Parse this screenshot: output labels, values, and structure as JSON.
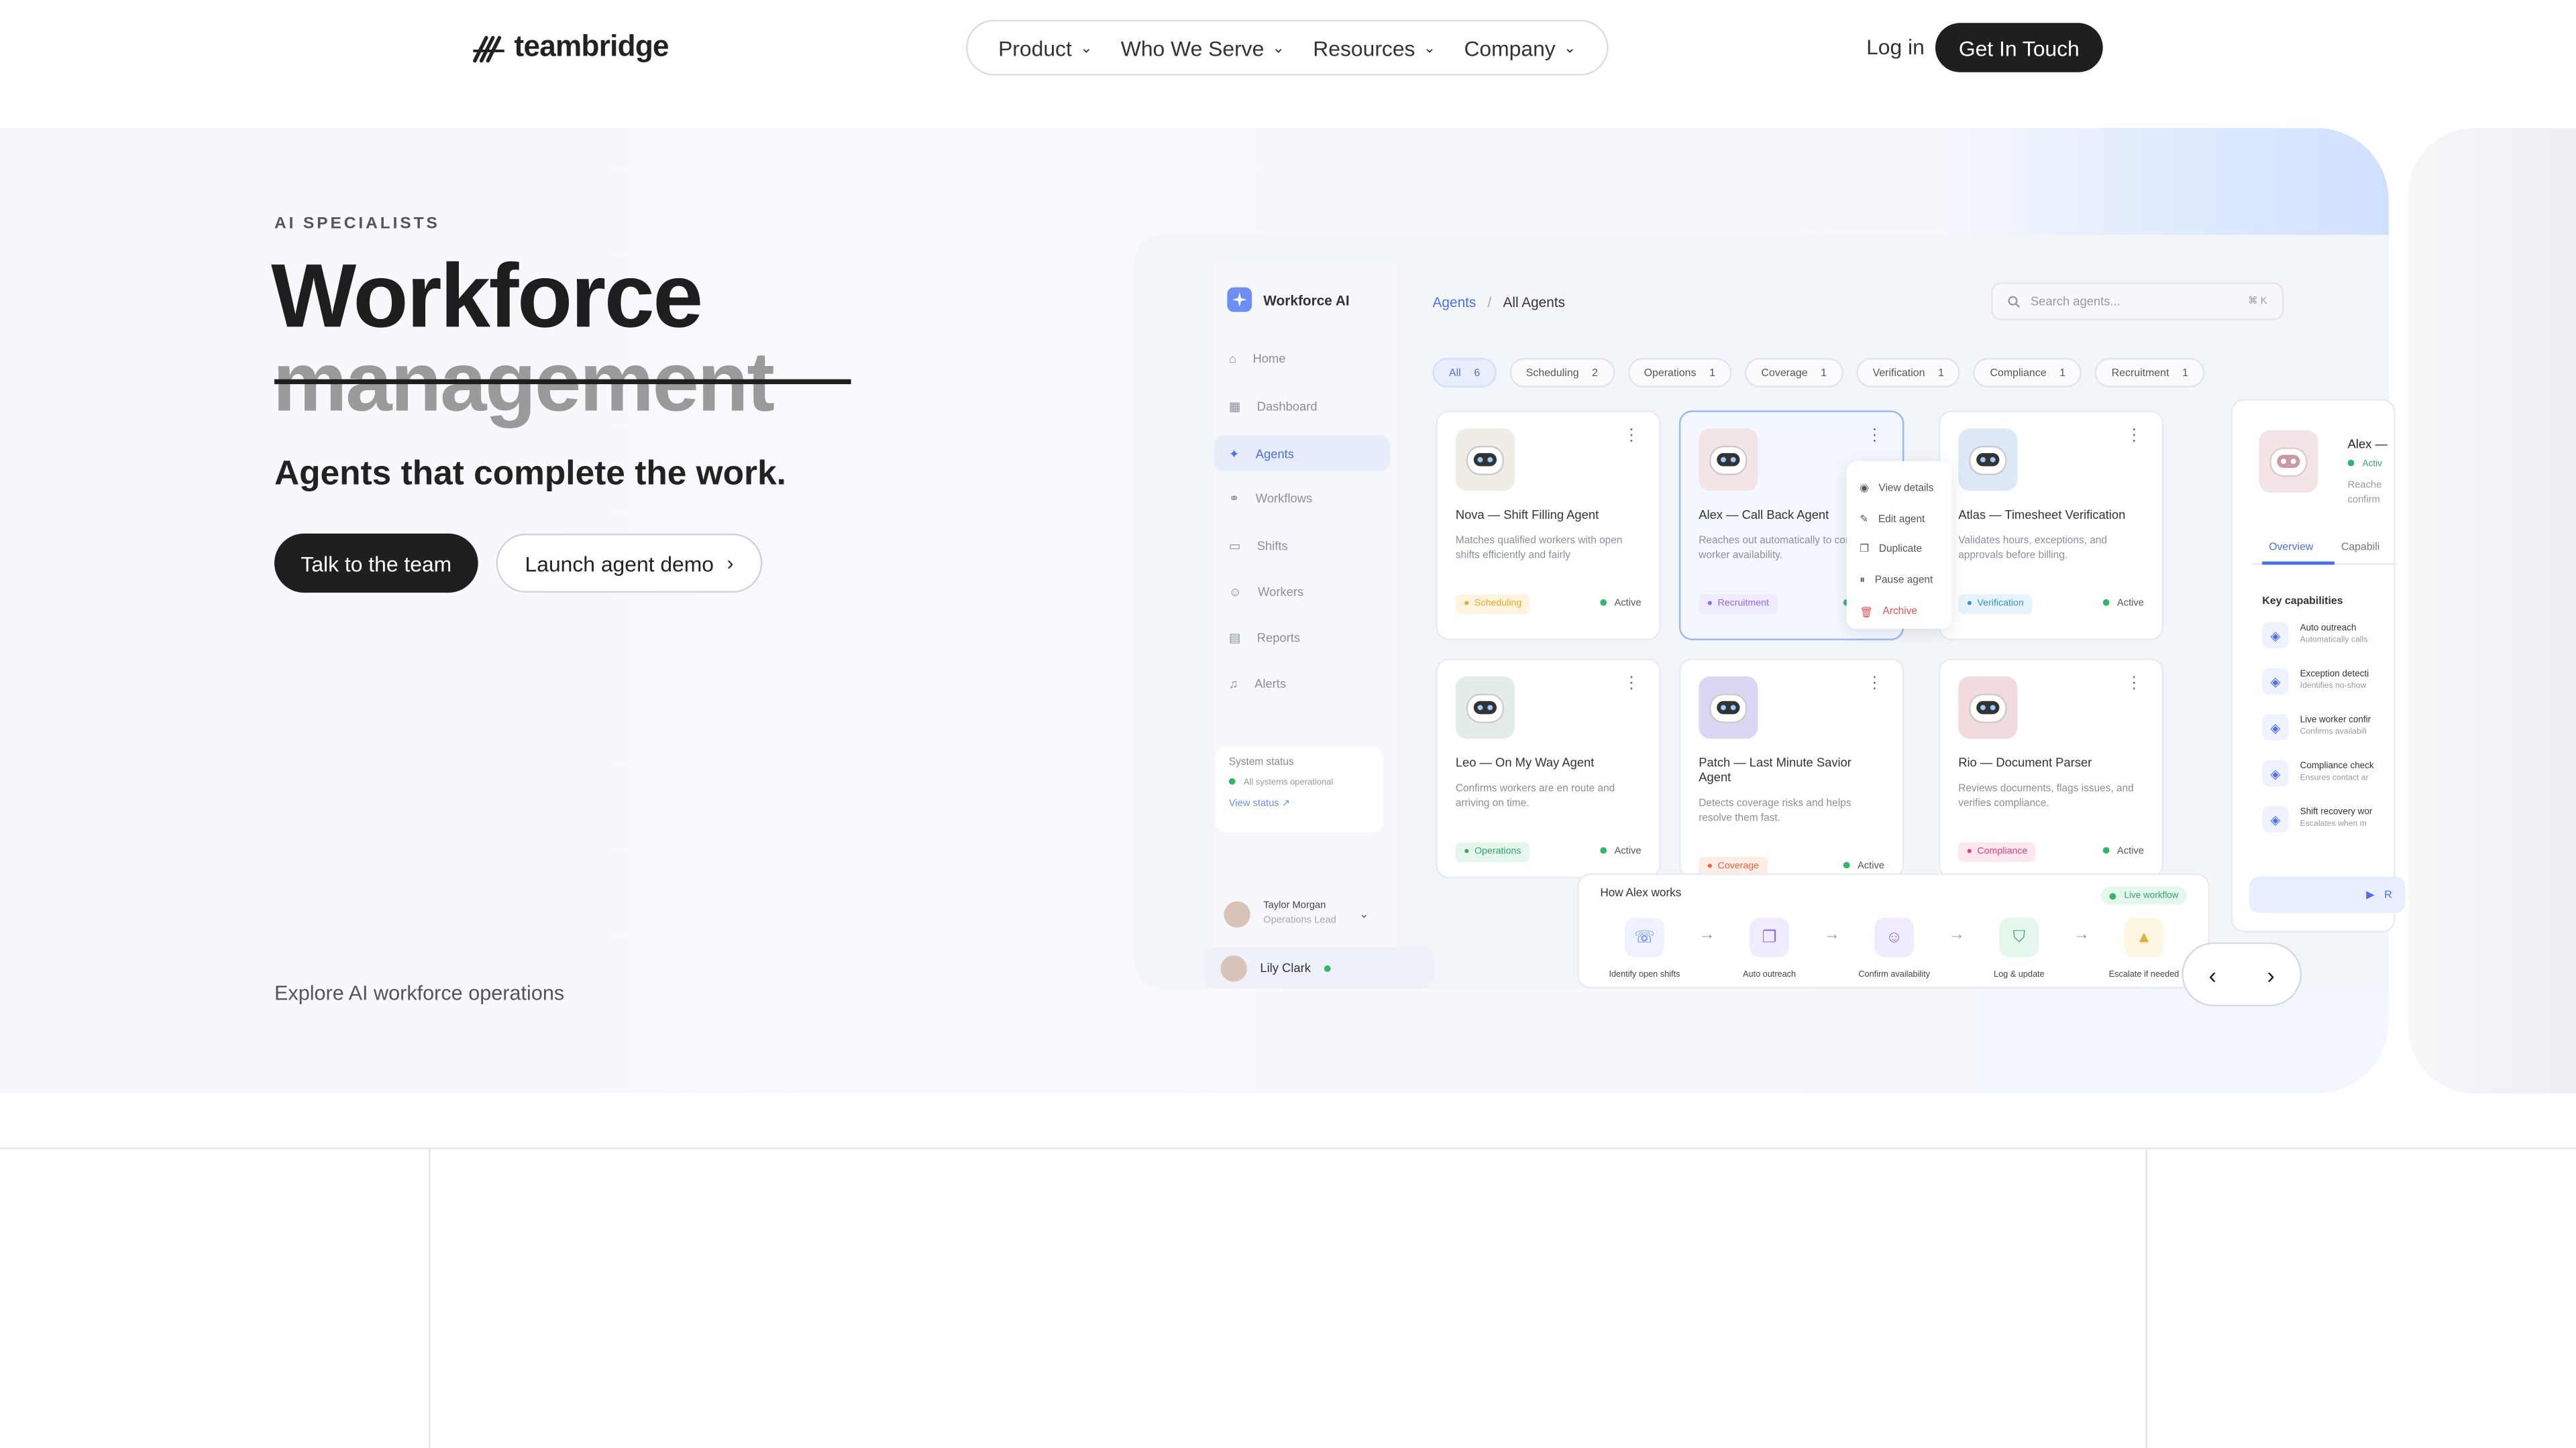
{
  "brand": {
    "name": "teambridge"
  },
  "nav": {
    "items": [
      "Product",
      "Who We Serve",
      "Resources",
      "Company"
    ],
    "login": "Log in",
    "cta": "Get In Touch"
  },
  "hero": {
    "eyebrow": "AI SPECIALISTS",
    "title_line1": "Workforce",
    "title_line2": "management",
    "subtitle": "Agents that complete the work.",
    "primary_cta": "Talk to the team",
    "secondary_cta": "Launch agent demo",
    "explore": "Explore AI workforce operations"
  },
  "app": {
    "title": "Workforce AI",
    "sidebar": [
      "Home",
      "Dashboard",
      "Agents",
      "Workflows",
      "Shifts",
      "Workers",
      "Reports",
      "Alerts"
    ],
    "system": {
      "title": "System status",
      "status": "All systems operational",
      "link": "View status"
    },
    "user1": {
      "name": "Taylor Morgan",
      "role": "Operations Lead"
    },
    "user2": {
      "name": "Lily Clark"
    },
    "breadcrumb": {
      "parent": "Agents",
      "current": "All Agents"
    },
    "search": {
      "placeholder": "Search agents...",
      "shortcut": "⌘ K"
    },
    "filters": [
      {
        "label": "All",
        "count": "6"
      },
      {
        "label": "Scheduling",
        "count": "2"
      },
      {
        "label": "Operations",
        "count": "1"
      },
      {
        "label": "Coverage",
        "count": "1"
      },
      {
        "label": "Verification",
        "count": "1"
      },
      {
        "label": "Compliance",
        "count": "1"
      },
      {
        "label": "Recruitment",
        "count": "1"
      }
    ],
    "agents": [
      {
        "name": "Nova — Shift Filling Agent",
        "desc": "Matches qualified workers with open shifts efficiently and fairly",
        "tag": "Scheduling",
        "status": "Active",
        "tagColor": "#f5a524",
        "tagBg": "#fff4e0",
        "robot": "#f0ece6"
      },
      {
        "name": "Alex — Call Back Agent",
        "desc": "Reaches out automatically to confirm worker availability.",
        "tag": "Recruitment",
        "status": "Active",
        "tagColor": "#8c6be8",
        "tagBg": "#f0ebff",
        "robot": "#f3e4e6"
      },
      {
        "name": "Atlas — Timesheet Verification",
        "desc": "Validates hours, exceptions, and approvals before billing.",
        "tag": "Verification",
        "status": "Active",
        "tagColor": "#3b8fd9",
        "tagBg": "#e6f2fc",
        "robot": "#dde9f7"
      },
      {
        "name": "Leo — On My Way Agent",
        "desc": "Confirms workers are en route and arriving on time.",
        "tag": "Operations",
        "status": "Active",
        "tagColor": "#2fa56b",
        "tagBg": "#e5f6ec",
        "robot": "#e3ecea"
      },
      {
        "name": "Patch — Last Minute Savior Agent",
        "desc": "Detects coverage risks and helps resolve them fast.",
        "tag": "Coverage",
        "status": "Active",
        "tagColor": "#e8653a",
        "tagBg": "#fdece5",
        "robot": "#dcd6f5"
      },
      {
        "name": "Rio — Document Parser",
        "desc": "Reviews documents, flags issues, and verifies compliance.",
        "tag": "Compliance",
        "status": "Active",
        "tagColor": "#d9407a",
        "tagBg": "#fde7ef",
        "robot": "#f2dadd"
      }
    ],
    "menu": [
      "View details",
      "Edit agent",
      "Duplicate",
      "Pause agent",
      "Archive"
    ],
    "detail": {
      "name": "Alex —",
      "status": "Activ",
      "line1": "Reache",
      "line2": "confirm",
      "tabs": [
        "Overview",
        "Capabili"
      ],
      "section": "Key capabilities",
      "capabilities": [
        {
          "title": "Auto outreach",
          "sub": "Automatically calls"
        },
        {
          "title": "Exception detecti",
          "sub": "Identifies no-show"
        },
        {
          "title": "Live worker confir",
          "sub": "Confirms availabili"
        },
        {
          "title": "Compliance check",
          "sub": "Ensures contact ar"
        },
        {
          "title": "Shift recovery wor",
          "sub": "Escalates when m"
        }
      ],
      "button": "R"
    },
    "works": {
      "title": "How Alex works",
      "badge": "Live workflow",
      "steps": [
        "Identify open shifts",
        "Auto outreach",
        "Confirm availability",
        "Log & update",
        "Escalate if needed"
      ]
    }
  },
  "colors": {
    "accent": "#4d6ee6",
    "dark": "#1f1f1f"
  }
}
